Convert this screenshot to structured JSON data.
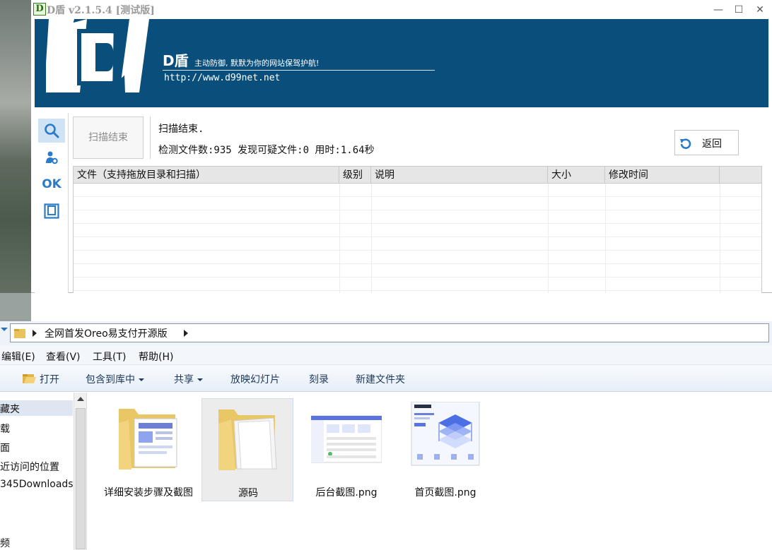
{
  "dshield": {
    "title": "D盾 v2.1.5.4 [测试版]",
    "app_icon_letter": "D",
    "window_controls": {
      "minimize": "—",
      "maximize": "☐",
      "close": "✕"
    },
    "banner": {
      "brand": "D盾",
      "slogan": "主动防御, 默默为你的网站保驾护航!",
      "url": "http://www.d99net.net",
      "bg_color": "#0a4f7c"
    },
    "sidebar": {
      "items": [
        {
          "name": "search",
          "icon": "search-icon"
        },
        {
          "name": "tools",
          "icon": "person-gear-icon"
        },
        {
          "name": "ok",
          "label": "OK"
        },
        {
          "name": "window",
          "icon": "window-icon"
        }
      ]
    },
    "scan_button_label": "扫描结束",
    "status_message": "扫描结束.",
    "scan_summary": "检测文件数:935 发现可疑文件:0 用时:1.64秒",
    "return_button_label": "返回",
    "table": {
      "columns": [
        "文件（支持拖放目录和扫描）",
        "级别",
        "说明",
        "大小",
        "修改时间"
      ],
      "rows": []
    }
  },
  "explorer": {
    "address": {
      "path": "全网首发Oreo易支付开源版"
    },
    "menu": [
      "编辑(E)",
      "查看(V)",
      "工具(T)",
      "帮助(H)"
    ],
    "toolbar": [
      "打开",
      "包含到库中",
      "共享",
      "放映幻灯片",
      "刻录",
      "新建文件夹"
    ],
    "nav_items": [
      "藏夹",
      "载",
      "面",
      "近访问的位置",
      "345Downloads",
      "频"
    ],
    "files": [
      {
        "name": "详细安装步骤及截图",
        "type": "folder-with-docs"
      },
      {
        "name": "源码",
        "type": "folder",
        "selected": true
      },
      {
        "name": "后台截图.png",
        "type": "image"
      },
      {
        "name": "首页截图.png",
        "type": "image"
      }
    ]
  }
}
